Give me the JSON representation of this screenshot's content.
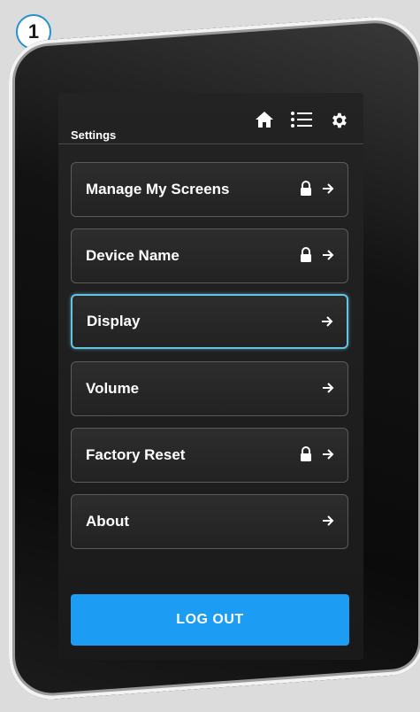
{
  "step_number": "1",
  "header": {
    "title": "Settings",
    "icons": [
      "home-icon",
      "list-icon",
      "gear-icon"
    ]
  },
  "menu": {
    "items": [
      {
        "label": "Manage My Screens",
        "locked": true,
        "selected": false
      },
      {
        "label": "Device Name",
        "locked": true,
        "selected": false
      },
      {
        "label": "Display",
        "locked": false,
        "selected": true
      },
      {
        "label": "Volume",
        "locked": false,
        "selected": false
      },
      {
        "label": "Factory Reset",
        "locked": true,
        "selected": false
      },
      {
        "label": "About",
        "locked": false,
        "selected": false
      }
    ]
  },
  "logout_label": "LOG OUT",
  "colors": {
    "accent": "#1d9cf4",
    "selected_border": "#62c6e3",
    "screen_bg": "#1f1f1f",
    "badge_border": "#2a8fd0"
  }
}
